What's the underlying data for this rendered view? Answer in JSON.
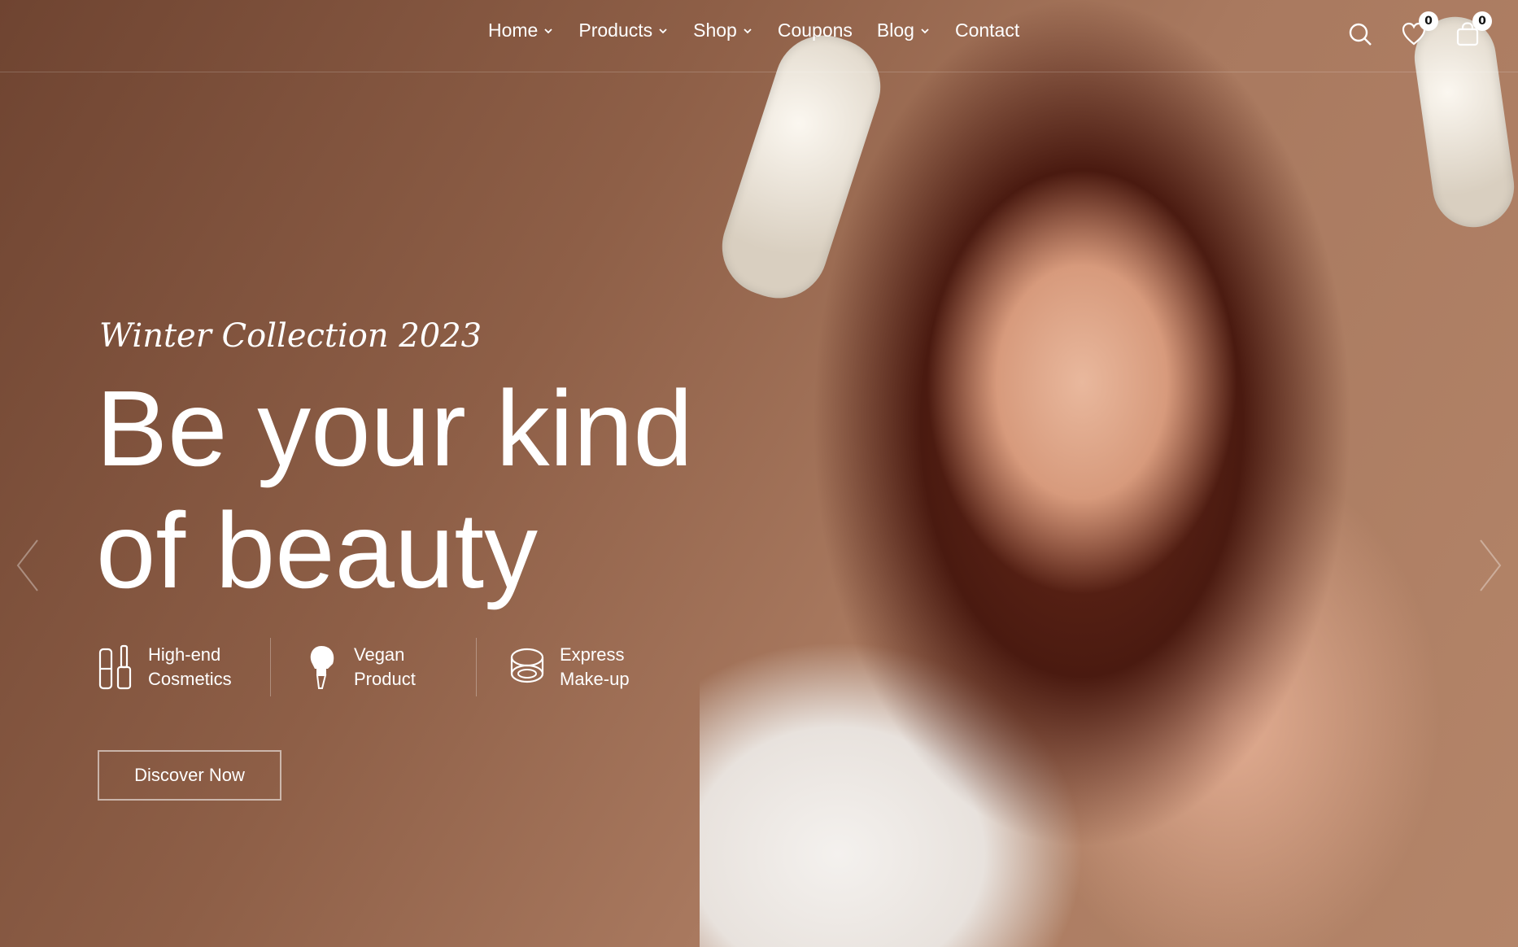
{
  "header": {
    "nav": [
      {
        "label": "Home",
        "has_dropdown": true
      },
      {
        "label": "Products",
        "has_dropdown": true
      },
      {
        "label": "Shop",
        "has_dropdown": true
      },
      {
        "label": "Coupons",
        "has_dropdown": false
      },
      {
        "label": "Blog",
        "has_dropdown": true
      },
      {
        "label": "Contact",
        "has_dropdown": false
      }
    ],
    "icons": {
      "search": "search-icon",
      "wishlist": "heart-icon",
      "cart": "shopping-bag-icon"
    },
    "wishlist_count": "0",
    "cart_count": "0"
  },
  "hero": {
    "tagline": "Winter Collection 2023",
    "headline": "Be your kind of beauty",
    "features": [
      {
        "icon": "cosmetics-icon",
        "label": "High-end Cosmetics"
      },
      {
        "icon": "brush-icon",
        "label": "Vegan Product"
      },
      {
        "icon": "compact-icon",
        "label": "Express Make-up"
      }
    ],
    "cta_label": "Discover Now"
  },
  "colors": {
    "background": "#8e5f47",
    "text": "#ffffff"
  }
}
